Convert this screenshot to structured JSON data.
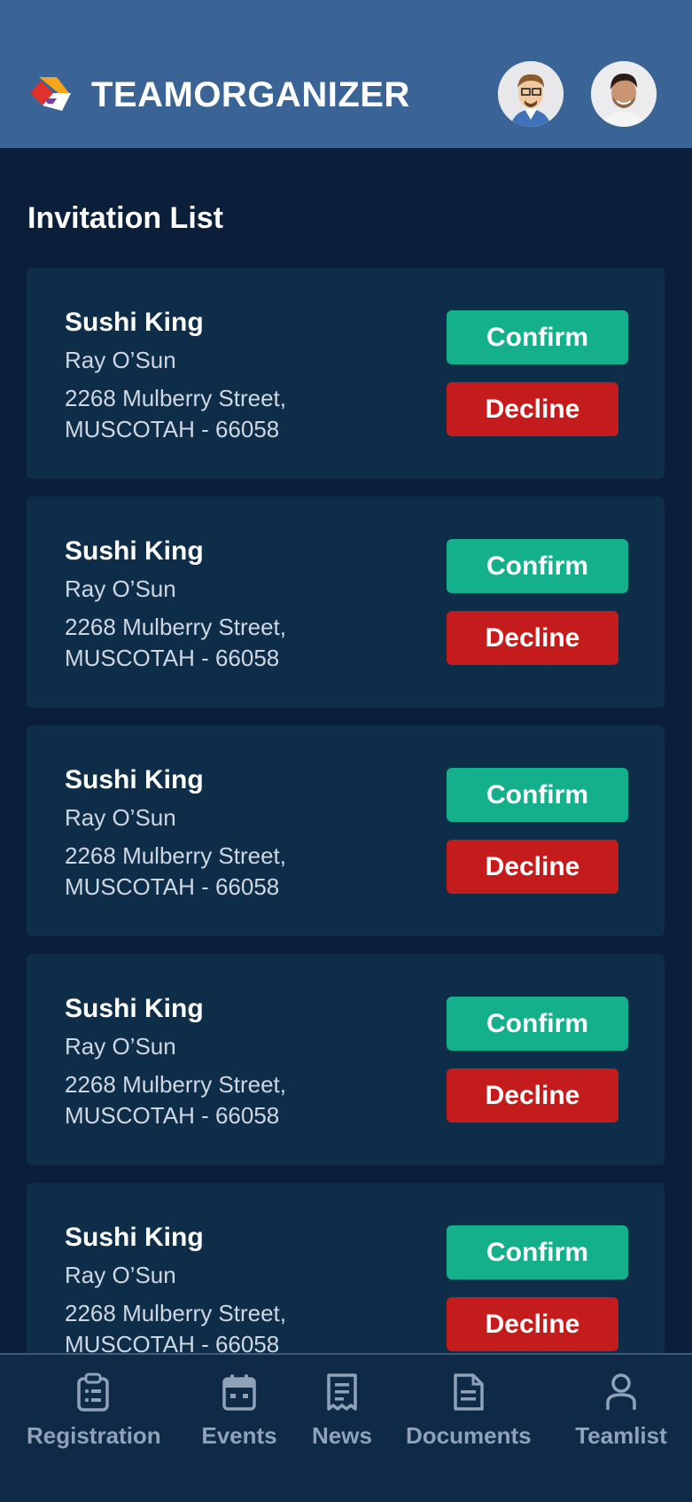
{
  "header": {
    "brand": "TEAMORGANIZER",
    "avatars": [
      "avatar-cartoon",
      "avatar-photo"
    ]
  },
  "page_title": "Invitation List",
  "invitations": [
    {
      "name": "Sushi King",
      "person": "Ray O’Sun",
      "address_line1": "2268 Mulberry Street,",
      "address_line2": "MUSCOTAH - 66058",
      "confirm_label": "Confirm",
      "decline_label": "Decline"
    },
    {
      "name": "Sushi King",
      "person": "Ray O’Sun",
      "address_line1": "2268 Mulberry Street,",
      "address_line2": "MUSCOTAH - 66058",
      "confirm_label": "Confirm",
      "decline_label": "Decline"
    },
    {
      "name": "Sushi King",
      "person": "Ray O’Sun",
      "address_line1": "2268 Mulberry Street,",
      "address_line2": "MUSCOTAH - 66058",
      "confirm_label": "Confirm",
      "decline_label": "Decline"
    },
    {
      "name": "Sushi King",
      "person": "Ray O’Sun",
      "address_line1": "2268 Mulberry Street,",
      "address_line2": "MUSCOTAH - 66058",
      "confirm_label": "Confirm",
      "decline_label": "Decline"
    },
    {
      "name": "Sushi King",
      "person": "Ray O’Sun",
      "address_line1": "2268 Mulberry Street,",
      "address_line2": "MUSCOTAH - 66058",
      "confirm_label": "Confirm",
      "decline_label": "Decline"
    }
  ],
  "bottom_nav": [
    {
      "label": "Registration",
      "icon": "clipboard-icon"
    },
    {
      "label": "Events",
      "icon": "calendar-icon"
    },
    {
      "label": "News",
      "icon": "receipt-icon"
    },
    {
      "label": "Documents",
      "icon": "document-icon"
    },
    {
      "label": "Teamlist",
      "icon": "person-icon"
    }
  ],
  "colors": {
    "header_bg": "#3a6496",
    "page_bg": "#0b1f3a",
    "card_bg": "#0d2d48",
    "confirm": "#14b08b",
    "decline": "#c41c1c",
    "nav_text": "#8fa2b8"
  }
}
